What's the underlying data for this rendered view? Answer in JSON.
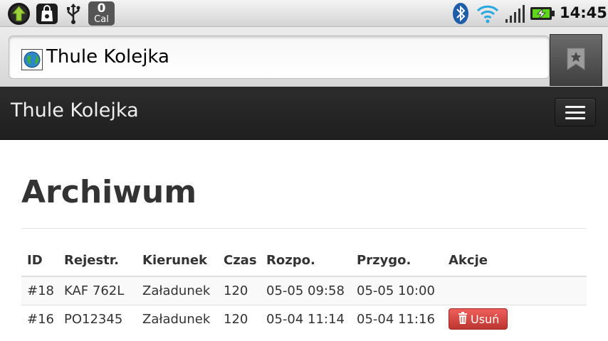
{
  "statusbar": {
    "calendar_number": "0",
    "calendar_label": "Cal",
    "time": "14:45",
    "icons": [
      "upload-icon",
      "shopping-bag-icon",
      "usb-icon",
      "calendar-icon",
      "bluetooth-icon",
      "wifi-icon",
      "signal-icon",
      "battery-charging-icon"
    ]
  },
  "browser": {
    "url_text": "Thule Kolejka",
    "favicon": "globe-icon",
    "bookmark_icon": "bookmark-star-icon"
  },
  "navbar": {
    "brand": "Thule Kolejka",
    "toggle_icon": "hamburger-menu-icon"
  },
  "page": {
    "title": "Archiwum"
  },
  "table": {
    "headers": [
      "ID",
      "Rejestr.",
      "Kierunek",
      "Czas",
      "Rozpo.",
      "Przygo.",
      "Akcje"
    ],
    "rows": [
      {
        "id": "#18",
        "reg": "KAF 762L",
        "direction": "Załadunek",
        "time": "120",
        "start": "05-05 09:58",
        "ready": "05-05 10:00",
        "action": ""
      },
      {
        "id": "#16",
        "reg": "PO12345",
        "direction": "Załadunek",
        "time": "120",
        "start": "05-04 11:14",
        "ready": "05-04 11:16",
        "action": "Usuń"
      }
    ],
    "delete_icon": "trash-icon"
  },
  "colors": {
    "navbar": "#222222",
    "danger": "#da4f49",
    "text": "#333333"
  }
}
